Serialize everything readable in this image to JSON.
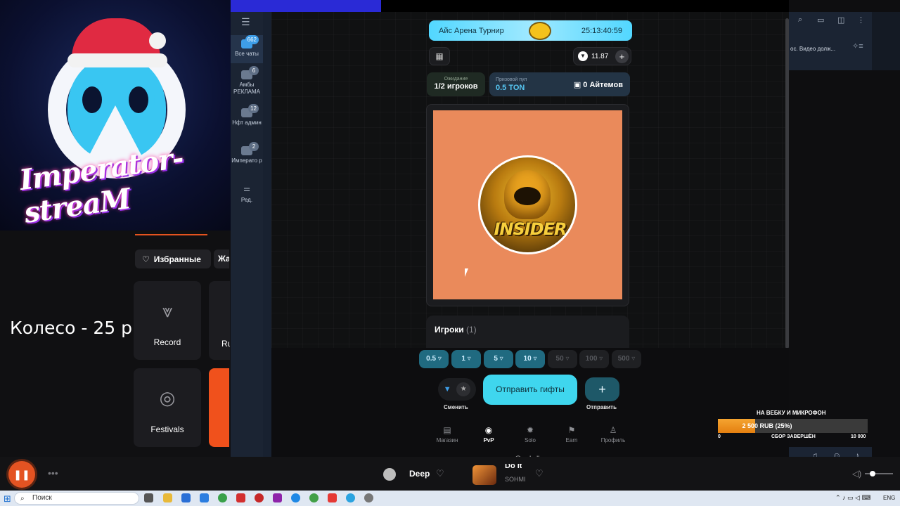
{
  "stream": {
    "logo_text": "Imperator-streaM",
    "wheel_price": "Колесо - 25 р"
  },
  "music_app": {
    "favorites_label": "Избранные",
    "genres_partial_label": "Жа",
    "tiles": [
      {
        "label": "Record",
        "icon": "record-logo-icon"
      },
      {
        "label": "Ru",
        "icon": "radio-icon"
      },
      {
        "label": "Festivals",
        "icon": "live-festival-icon"
      }
    ],
    "player": {
      "station": "Deep",
      "track_title": "Do It",
      "track_artist": "SOHMI",
      "accent_color": "#e45322"
    }
  },
  "telegram": {
    "folders": [
      {
        "label": "Все чаты",
        "badge": "662",
        "active": true
      },
      {
        "label": "Амбы РЕКЛАМА",
        "badge": "6"
      },
      {
        "label": "Нфт админ",
        "badge": "12"
      },
      {
        "label": "Императо р",
        "badge": "2"
      },
      {
        "label": "Ред.",
        "badge": ""
      }
    ],
    "pinned_message_preview": "ос. Видео долж..."
  },
  "app": {
    "banner": {
      "title": "Айс Арена Турнир",
      "timer": "25:13:40:59"
    },
    "balance": "11.87",
    "waiting": {
      "label": "Ожидание",
      "value": "1/2 игроков"
    },
    "prize_pool": {
      "label": "Призовой пул",
      "value": "0.5 TON",
      "items": "0 Айтемов"
    },
    "avatar_text": "INSIDER",
    "wheel_color": "#ea8a5b",
    "players": {
      "title": "Игроки",
      "count": "(1)"
    },
    "amounts": [
      {
        "label": "0.5",
        "active": true
      },
      {
        "label": "1",
        "active": true
      },
      {
        "label": "5",
        "active": true
      },
      {
        "label": "10",
        "active": true
      },
      {
        "label": "50",
        "active": false
      },
      {
        "label": "100",
        "active": false
      },
      {
        "label": "500",
        "active": false
      }
    ],
    "swap_label": "Сменить",
    "send_gifts_label": "Отправить гифты",
    "send_label": "Отправить",
    "nav": [
      {
        "label": "Магазин",
        "icon": "shop-icon",
        "active": false
      },
      {
        "label": "PvP",
        "icon": "pvp-icon",
        "active": true
      },
      {
        "label": "Solo",
        "icon": "solo-icon",
        "active": false
      },
      {
        "label": "Earn",
        "icon": "earn-icon",
        "active": false
      },
      {
        "label": "Профиль",
        "icon": "profile-icon",
        "active": false
      }
    ],
    "handle": "@myballs"
  },
  "donation_goal": {
    "title": "НА ВЕБКУ И МИКРОФОН",
    "progress_text": "2 500 RUB (25%)",
    "progress_fraction": 0.25,
    "min": "0",
    "status": "СБОР ЗАВЕРШЁН",
    "max": "10 000"
  },
  "taskbar": {
    "search_placeholder": "Поиск",
    "language": "ENG"
  }
}
